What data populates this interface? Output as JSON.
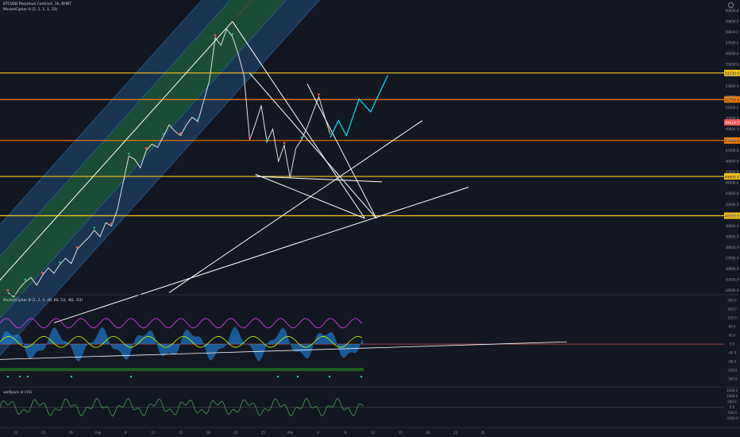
{
  "header": {
    "title": "BTCUSD Perpetual Contract, 1h, BYBIT",
    "ind_main": "MarketCipher A (2, 1, 1, 1, 33)",
    "ind_b": "MarketCipher B (2, 2, 4, 40, 60, 53, -60, -53)",
    "ind_c": "wolfpack id (VS)"
  },
  "colors": {
    "background": "#131722",
    "channel_outer": "#1f4e79",
    "channel_inner": "#1b5e20",
    "hline_yellow": "#f5c518",
    "hline_orange": "#f57c00",
    "price_line": "#e0e0e0",
    "projection": "#00e5ff"
  },
  "chart_data": {
    "type": "line",
    "title": "",
    "price_axis": [
      "60000.0",
      "59000.0",
      "58000.0",
      "57000.0",
      "56000.0",
      "55000.0",
      "54000.0",
      "53000.0",
      "52000.0",
      "51000.0",
      "50000.0",
      "49000.0",
      "48000.0",
      "47000.0",
      "46000.0",
      "45000.0",
      "44000.0",
      "43000.0",
      "42000.0",
      "41000.0",
      "40000.0",
      "39000.0",
      "38000.0",
      "37000.0",
      "36000.0",
      "35000.0",
      "34000.0"
    ],
    "ylim": [
      33600,
      61000
    ],
    "date_axis": [
      "22",
      "25",
      "29",
      "Feb",
      "8",
      "11",
      "15",
      "18",
      "22",
      "25",
      "Mar",
      "4",
      "8",
      "11",
      "15",
      "18",
      "22",
      "25"
    ],
    "hlines": [
      {
        "price": 54220,
        "label": "54220.0",
        "color": "yellow"
      },
      {
        "price": 51750,
        "label": "51750.0",
        "color": "orange"
      },
      {
        "price": 47940,
        "label": "47940.0",
        "color": "orange"
      },
      {
        "price": 44600,
        "label": "44600.0",
        "color": "yellow"
      },
      {
        "price": 40950,
        "label": "40950.0",
        "color": "yellow"
      }
    ],
    "last_price_label": "49619.7",
    "price_close": [
      [
        0,
        33800
      ],
      [
        0.5,
        33400
      ],
      [
        1,
        34200
      ],
      [
        1.5,
        34800
      ],
      [
        2,
        35200
      ],
      [
        2.5,
        34500
      ],
      [
        3,
        35400
      ],
      [
        3.5,
        36100
      ],
      [
        4,
        35600
      ],
      [
        4.5,
        36400
      ],
      [
        5,
        37000
      ],
      [
        5.5,
        36500
      ],
      [
        6,
        37800
      ],
      [
        6.5,
        38400
      ],
      [
        7,
        38900
      ],
      [
        7.5,
        39600
      ],
      [
        8,
        39000
      ],
      [
        8.5,
        40300
      ],
      [
        9,
        40000
      ],
      [
        9.5,
        41500
      ],
      [
        10,
        44000
      ],
      [
        10.5,
        46500
      ],
      [
        11,
        46200
      ],
      [
        11.5,
        45400
      ],
      [
        12,
        47000
      ],
      [
        12.5,
        47600
      ],
      [
        13,
        47300
      ],
      [
        13.5,
        48300
      ],
      [
        14,
        49400
      ],
      [
        14.5,
        48800
      ],
      [
        15,
        48400
      ],
      [
        15.5,
        49400
      ],
      [
        16,
        50100
      ],
      [
        16.5,
        49700
      ],
      [
        17,
        51600
      ],
      [
        17.5,
        53500
      ],
      [
        18,
        57500
      ],
      [
        18.5,
        56800
      ],
      [
        19,
        58300
      ],
      [
        19.5,
        57600
      ],
      [
        20,
        56000
      ],
      [
        20.5,
        54000
      ],
      [
        21,
        48000
      ],
      [
        21.5,
        49500
      ],
      [
        22,
        51200
      ],
      [
        22.5,
        47800
      ],
      [
        23,
        49000
      ],
      [
        23.5,
        46000
      ],
      [
        24,
        47500
      ],
      [
        24.5,
        44500
      ],
      [
        25,
        47200
      ],
      [
        25.5,
        48000
      ],
      [
        26,
        49200
      ],
      [
        26.5,
        50600
      ],
      [
        27,
        52000
      ],
      [
        27.5,
        50200
      ],
      [
        28,
        48500
      ]
    ],
    "projection": [
      [
        28,
        48200
      ],
      [
        28.7,
        49800
      ],
      [
        29.4,
        48400
      ],
      [
        30.5,
        51800
      ],
      [
        31.5,
        50600
      ],
      [
        33,
        54000
      ]
    ],
    "trendlines": [
      {
        "from": [
          -1.5,
          34000
        ],
        "to": [
          19.5,
          59000
        ]
      },
      {
        "from": [
          19.5,
          59000
        ],
        "to": [
          31,
          40700
        ]
      },
      {
        "from": [
          21,
          54200
        ],
        "to": [
          32,
          40700
        ]
      },
      {
        "from": [
          21.5,
          44800
        ],
        "to": [
          31,
          40700
        ]
      },
      {
        "from": [
          26,
          53200
        ],
        "to": [
          32,
          40700
        ]
      },
      {
        "from": [
          4,
          31000
        ],
        "to": [
          40,
          43600
        ]
      },
      {
        "from": [
          14,
          33800
        ],
        "to": [
          36,
          49800
        ]
      },
      {
        "from": [
          21.5,
          44600
        ],
        "to": [
          32.5,
          44100
        ]
      }
    ],
    "indicator_b": {
      "axis": [
        "200.0",
        "160.0",
        "120.0",
        "80.0",
        "40.0",
        "0.0",
        "-40.0",
        "-80.0",
        "-120.0",
        "-160.0"
      ],
      "ylim": [
        -170,
        210
      ]
    },
    "indicator_c": {
      "axis": [
        "1500.0",
        "1000.0",
        "500.0",
        "0.0",
        "-500.0",
        "-1000.0"
      ],
      "ylim": [
        -1600,
        1600
      ]
    }
  }
}
